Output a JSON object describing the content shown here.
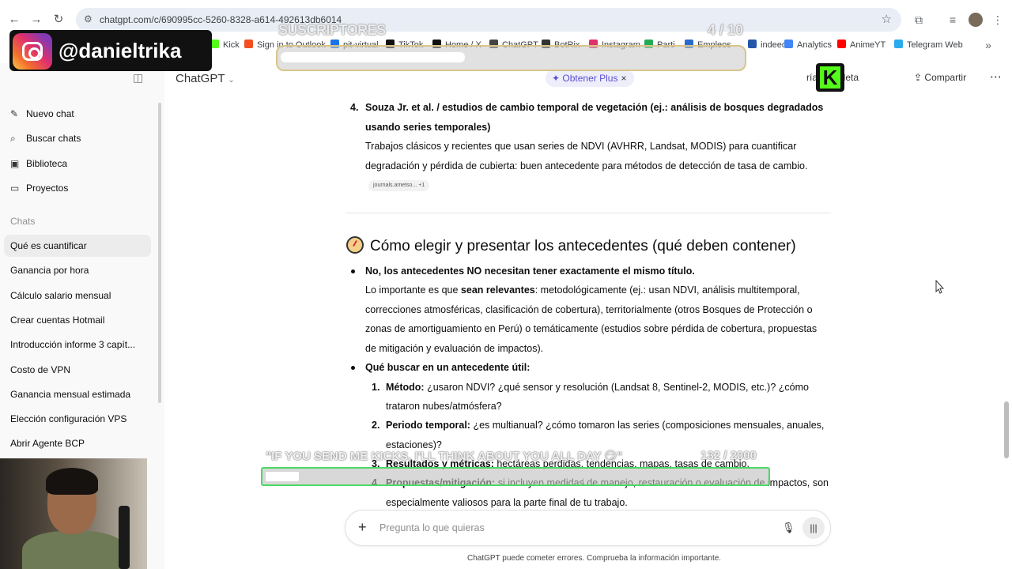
{
  "browser": {
    "url": "chatgpt.com/c/690995cc-5260-8328-a614-492613db6014",
    "bookmarks": [
      {
        "label": "Kick",
        "color": "#53fc18"
      },
      {
        "label": "Sign in to Outlook",
        "color": "#f25022"
      },
      {
        "label": "pit-virtual",
        "color": "#1a73e8"
      },
      {
        "label": "TikTok",
        "color": "#111111"
      },
      {
        "label": "Home / X",
        "color": "#111111"
      },
      {
        "label": "ChatGPT",
        "color": "#444444"
      },
      {
        "label": "BotRix",
        "color": "#333333"
      },
      {
        "label": "Instagram",
        "color": "#e1306c"
      },
      {
        "label": "Parti",
        "color": "#22aa55"
      },
      {
        "label": "Empleos",
        "color": "#2a6acf"
      },
      {
        "label": "indeed",
        "color": "#2557a7"
      },
      {
        "label": "Analytics",
        "color": "#4285f4"
      },
      {
        "label": "AnimeYT",
        "color": "#ff0000"
      },
      {
        "label": "Telegram Web",
        "color": "#2aabee"
      }
    ]
  },
  "overlay": {
    "handle": "@danieltrika",
    "subs_label": "SUSCRIPTORES",
    "subs_count": "4 / 10",
    "subs_progress": 0.4,
    "goal_label": "\"IF YOU SEND ME KICKS, I'LL THINK ABOUT YOU ALL DAY 😏\"",
    "goal_count": "132 / 2000",
    "goal_progress": 0.066,
    "kick_letter": "K"
  },
  "sidebar": {
    "nav": [
      {
        "label": "Nuevo chat",
        "icon": "✎"
      },
      {
        "label": "Buscar chats",
        "icon": "⌕"
      },
      {
        "label": "Biblioteca",
        "icon": "▣"
      },
      {
        "label": "Proyectos",
        "icon": "▭"
      }
    ],
    "section_label": "Chats",
    "chats": [
      "Qué es cuantificar",
      "Ganancia por hora",
      "Cálculo salario mensual",
      "Crear cuentas Hotmail",
      "Introducción informe 3 capít...",
      "Costo de VPN",
      "Ganancia mensual estimada",
      "Elección configuración VPS",
      "Abrir Agente BCP"
    ]
  },
  "topbar": {
    "model": "ChatGPT",
    "plus_label": "Obtener Plus",
    "full_label": "ría completa",
    "share_label": "Compartir"
  },
  "content": {
    "item4_num": "4.",
    "item4_title_1": "Souza Jr. et al. / estudios de cambio temporal de vegetación (ej.: análisis de bosques degradados",
    "item4_title_2": "usando series temporales)",
    "item4_body_1": "Trabajos clásicos y recientes que usan series de NDVI (AVHRR, Landsat, MODIS) para cuantificar",
    "item4_body_2": "degradación y pérdida de cubierta: buen antecedente para métodos de detección de tasa de cambio.",
    "cite": "journals.ametso...  +1",
    "heading": "Cómo elegir y presentar los antecedentes (qué deben contener)",
    "b1_title": "No, los antecedentes NO necesitan tener exactamente el mismo título.",
    "b1_l1_a": "Lo importante es que ",
    "b1_l1_b": "sean relevantes",
    "b1_l1_c": ": metodológicamente (ej.: usan NDVI, análisis multitemporal,",
    "b1_l2": "correcciones atmosféricas, clasificación de cobertura), territorialmente (otros Bosques de Protección o",
    "b1_l3": "zonas de amortiguamiento en Perú) o temáticamente (estudios sobre pérdida de cobertura, propuestas",
    "b1_l4": "de mitigación y evaluación de impactos).",
    "b2_title": "Qué buscar en un antecedente útil:",
    "s1_num": "1.",
    "s1_label": "Método:",
    "s1_l1": "¿usaron NDVI? ¿qué sensor y resolución (Landsat 8, Sentinel-2, MODIS, etc.)? ¿cómo",
    "s1_l2": "trataron nubes/atmósfera?",
    "s2_num": "2.",
    "s2_label": "Periodo temporal:",
    "s2_l1": "¿es multianual? ¿cómo tomaron las series (composiciones mensuales, anuales,",
    "s2_l2": "estaciones)?",
    "s3_num": "3.",
    "s3_label": "Resultados y métricas:",
    "s3_l1": "hectáreas perdidas, tendencias, mapas, tasas de cambio.",
    "s4_num": "4.",
    "s4_label": "Propuestas/mitigación:",
    "s4_l1": "si incluyen medidas de manejo, restauración o evaluación de impactos, son",
    "s4_l2": "especialmente valiosos para la parte final de tu trabajo."
  },
  "composer": {
    "placeholder": "Pregunta lo que quieras"
  },
  "footer": {
    "disclaimer": "ChatGPT puede cometer errores. Comprueba la información importante."
  }
}
